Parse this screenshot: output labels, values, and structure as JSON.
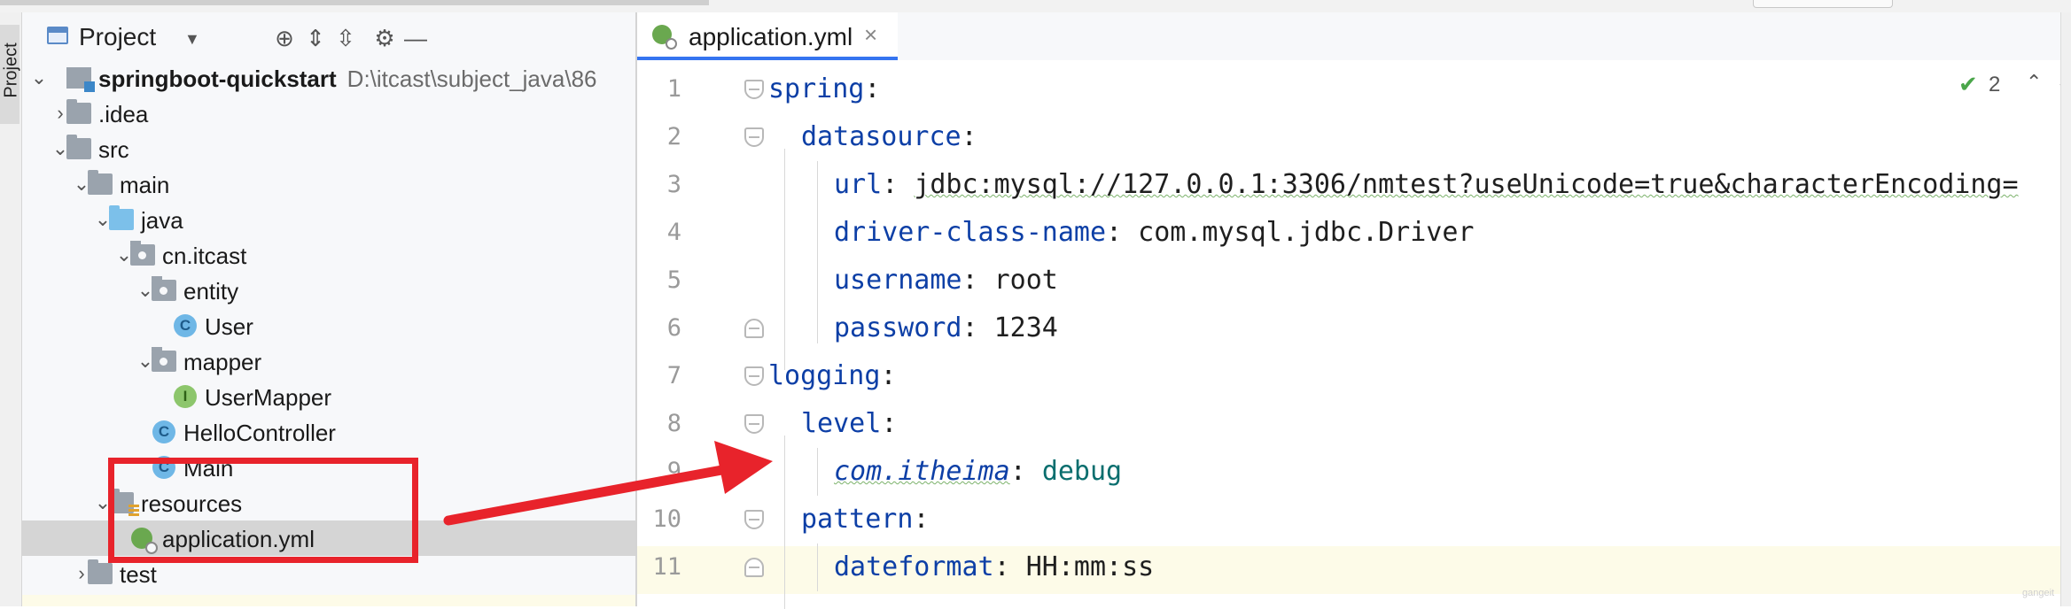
{
  "project_panel": {
    "title": "Project",
    "dropdown_icon": "chevron-down-icon",
    "toolbar_icons": [
      "locate-icon",
      "expand-all-icon",
      "collapse-all-icon",
      "gear-icon",
      "minimize-icon"
    ],
    "stripe_label": "Project"
  },
  "tree": [
    {
      "label": "springboot-quickstart",
      "path": "D:\\itcast\\subject_java\\86",
      "bold": true
    },
    {
      "label": ".idea"
    },
    {
      "label": "src"
    },
    {
      "label": "main"
    },
    {
      "label": "java"
    },
    {
      "label": "cn.itcast"
    },
    {
      "label": "entity"
    },
    {
      "label": "User",
      "badge": "C"
    },
    {
      "label": "mapper"
    },
    {
      "label": "UserMapper",
      "badge": "I"
    },
    {
      "label": "HelloController",
      "badge": "C"
    },
    {
      "label": "Main",
      "badge": "C"
    },
    {
      "label": "resources"
    },
    {
      "label": "application.yml"
    },
    {
      "label": "test"
    }
  ],
  "editor": {
    "tab_label": "application.yml",
    "tab_close": "×",
    "inspection_count": "2",
    "line_numbers": [
      "1",
      "2",
      "3",
      "4",
      "5",
      "6",
      "7",
      "8",
      "9",
      "10",
      "11"
    ],
    "lines": [
      {
        "key": "spring",
        "sep": ":",
        "value": ""
      },
      {
        "key": "datasource",
        "sep": ":",
        "value": ""
      },
      {
        "key": "url",
        "sep": ": ",
        "value": "jdbc:mysql://127.0.0.1:3306/nmtest?useUnicode=true&characterEncoding="
      },
      {
        "key": "driver-class-name",
        "sep": ": ",
        "value": "com.mysql.jdbc.Driver"
      },
      {
        "key": "username",
        "sep": ": ",
        "value": "root"
      },
      {
        "key": "password",
        "sep": ": ",
        "value": "1234"
      },
      {
        "key": "logging",
        "sep": ":",
        "value": ""
      },
      {
        "key": "level",
        "sep": ":",
        "value": ""
      },
      {
        "key": "com.itheima",
        "sep": ": ",
        "value": "debug"
      },
      {
        "key": "pattern",
        "sep": ":",
        "value": ""
      },
      {
        "key": "dateformat",
        "sep": ": ",
        "value": "HH:mm:ss"
      }
    ]
  },
  "watermark": "gangeit",
  "colors": {
    "accent": "#3574f0",
    "annotation": "#e8232b",
    "yaml_key": "#0d3fa6"
  }
}
